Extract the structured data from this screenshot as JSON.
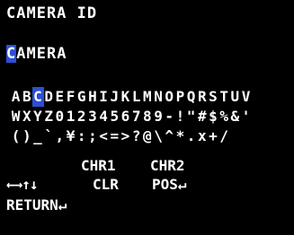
{
  "title": "CAMERA ID",
  "field": {
    "cursor_char": "C",
    "rest": "AMERA"
  },
  "keyboard": {
    "rows": [
      [
        "A",
        "B",
        "C",
        "D",
        "E",
        "F",
        "G",
        "H",
        "I",
        "J",
        "K",
        "L",
        "M",
        "N",
        "O",
        "P",
        "Q",
        "R",
        "S",
        "T",
        "U",
        "V"
      ],
      [
        "W",
        "X",
        "Y",
        "Z",
        "0",
        "1",
        "2",
        "3",
        "4",
        "5",
        "6",
        "7",
        "8",
        "9",
        "-",
        "!",
        "\"",
        "#",
        "$",
        "%",
        "&",
        "'"
      ],
      [
        "(",
        ")",
        "_",
        "`",
        ",",
        "¥",
        ":",
        ";",
        "<",
        "=",
        ">",
        "?",
        "@",
        "\\",
        "^",
        "*",
        ".",
        "x",
        "+",
        "/"
      ]
    ],
    "selected_row": 0,
    "selected_index": 2
  },
  "controls": {
    "chr1": "CHR1",
    "chr2": "CHR2",
    "arrows": "←→↑↓",
    "clr": "CLR",
    "pos": "POS↵",
    "return": "RETURN↵"
  }
}
